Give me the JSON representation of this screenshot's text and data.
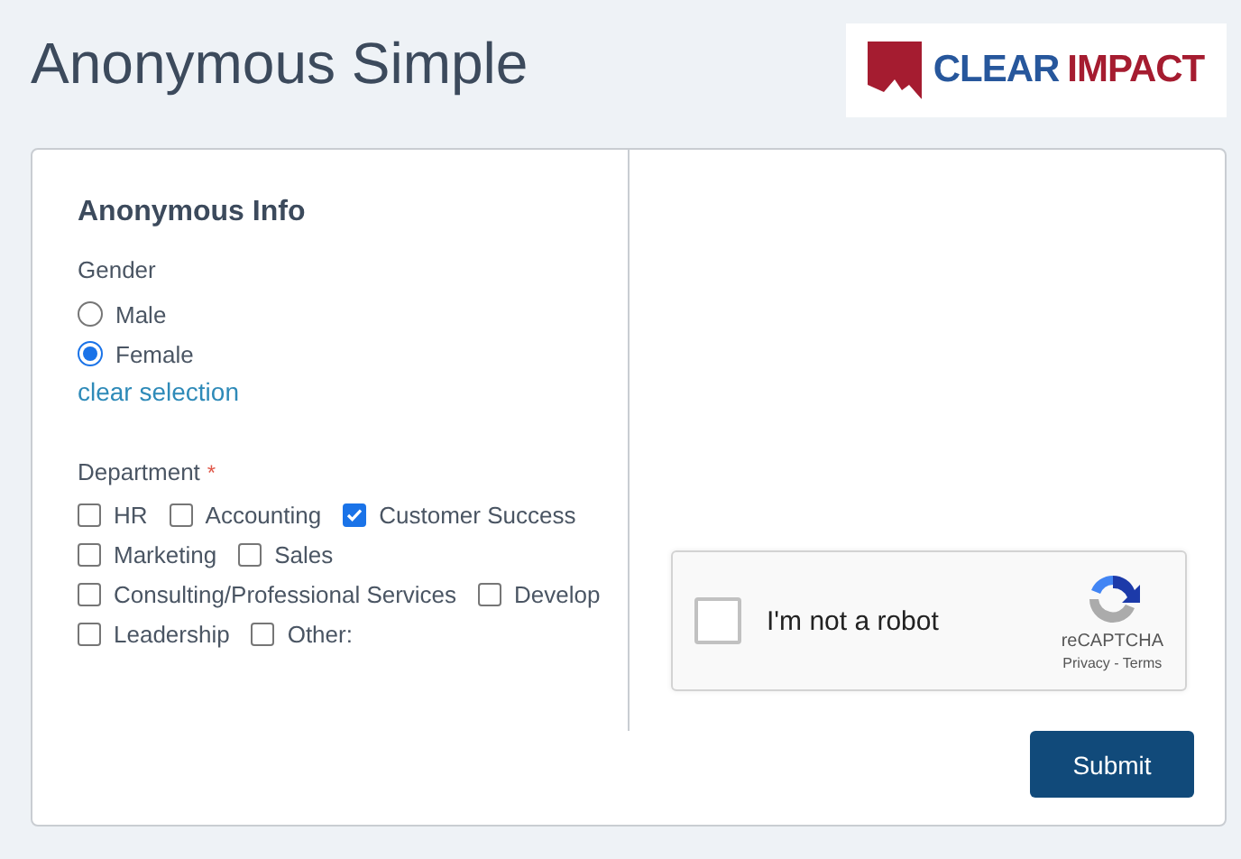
{
  "page_title": "Anonymous Simple",
  "logo": {
    "word_1": "CLEAR",
    "word_2": "IMPACT"
  },
  "section_title": "Anonymous Info",
  "gender": {
    "label": "Gender",
    "options": [
      {
        "label": "Male",
        "selected": false
      },
      {
        "label": "Female",
        "selected": true
      }
    ],
    "clear_link": "clear selection"
  },
  "department": {
    "label": "Department",
    "required_mark": "*",
    "options": [
      {
        "label": "HR",
        "checked": false
      },
      {
        "label": "Accounting",
        "checked": false
      },
      {
        "label": "Customer Success",
        "checked": true
      },
      {
        "label": "Marketing",
        "checked": false
      },
      {
        "label": "Sales",
        "checked": false
      },
      {
        "label": "Consulting/Professional Services",
        "checked": false
      },
      {
        "label": "Develop",
        "checked": false
      },
      {
        "label": "Leadership",
        "checked": false
      },
      {
        "label": "Other:",
        "checked": false
      }
    ]
  },
  "captcha": {
    "label": "I'm not a robot",
    "checked": false,
    "brand": "reCAPTCHA",
    "links": "Privacy - Terms"
  },
  "submit_button": "Submit"
}
